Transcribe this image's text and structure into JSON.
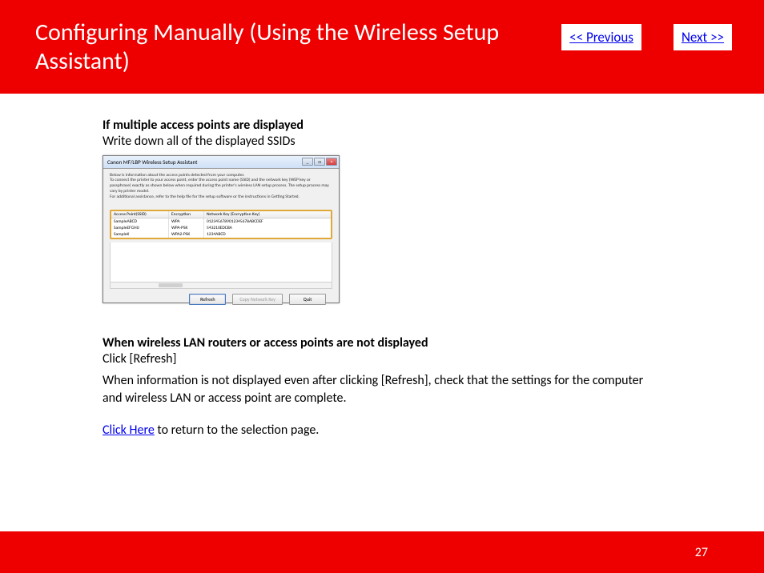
{
  "header": {
    "title": "Configuring Manually (Using the Wireless Setup Assistant)",
    "prev": "<< Previous",
    "next": "Next >>"
  },
  "section1": {
    "heading": "If multiple access points are displayed",
    "text": "Write down all of the displayed SSIDs"
  },
  "dialog": {
    "title": "Canon MF/LBP Wireless Setup Assistant",
    "info1": "Below is information about the access points detected from your computer.",
    "info2": "To connect the printer to your access point, enter the access point name (SSID) and the network key (WEP key or passphrase) exactly as shown below when required during the printer's wireless LAN setup process. The setup process may vary by printer model.",
    "info3": "For additional assistance, refer to the help file for the setup software or the instructions in Getting Started.",
    "col1": "Access Point(SSID)",
    "col2": "Encryption",
    "col3": "Network Key (Encryption Key)",
    "rows": [
      {
        "ssid": "SampleABCD",
        "enc": "WPA",
        "key": "0123456789012345678ABCDEF"
      },
      {
        "ssid": "SampleEFGHIJ",
        "enc": "WPA-PSK",
        "key": "543210EDCBA"
      },
      {
        "ssid": "SampleK",
        "enc": "WPA2-PSK",
        "key": "1234ABCD"
      }
    ],
    "refresh": "Refresh",
    "copy": "Copy Network Key",
    "quit": "Quit"
  },
  "section2": {
    "heading": "When wireless LAN routers or access points are not displayed",
    "text1": "Click [Refresh]",
    "text2": "When information is not displayed even after clicking [Refresh], check that the settings for the computer and wireless LAN or access point are complete."
  },
  "returnLine": {
    "link": "Click Here",
    "rest": " to return to the selection page."
  },
  "footer": {
    "pageNumber": "27"
  }
}
